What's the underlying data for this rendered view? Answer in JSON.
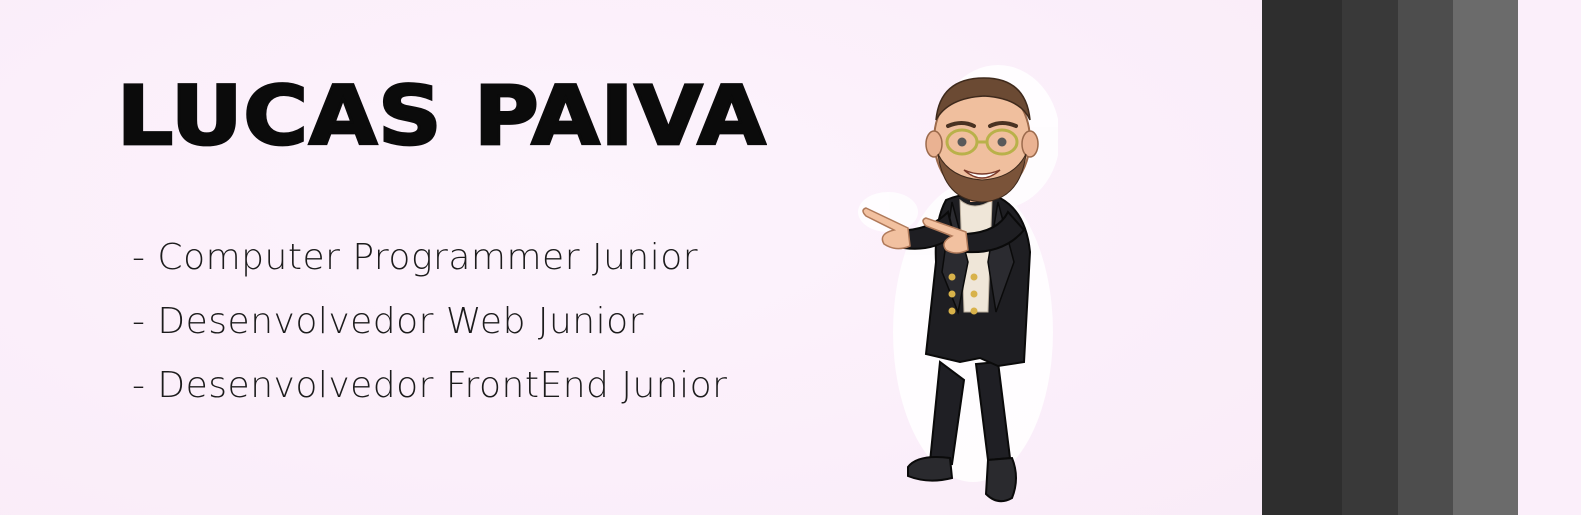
{
  "banner": {
    "title": "LUCAS PAIVA",
    "roles": [
      "- Computer Programmer Junior",
      "- Desenvolvedor Web Junior",
      "- Desenvolvedor FrontEnd Junior"
    ]
  },
  "colors": {
    "background": "#fbeffa",
    "text": "#0b0b0b",
    "stripe_1": "#2e2e2e",
    "stripe_2": "#393939",
    "stripe_3": "#4d4d4d",
    "stripe_4": "#6b6b6b",
    "stripe_edge": "#fbeffa"
  },
  "illustration": {
    "icon": "cartoon-avatar-pointing-left"
  }
}
